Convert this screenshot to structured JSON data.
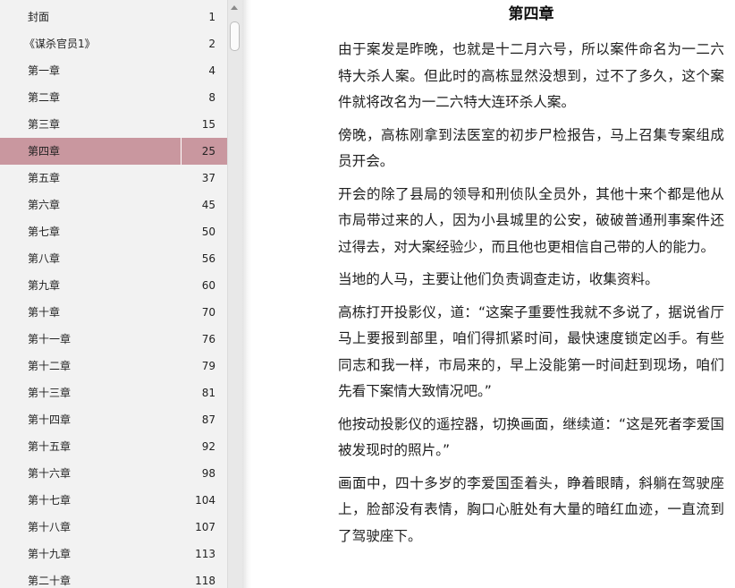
{
  "toc": {
    "items": [
      {
        "title": "封面",
        "page": "1"
      },
      {
        "title": "《谋杀官员1》",
        "page": "2"
      },
      {
        "title": "第一章",
        "page": "4"
      },
      {
        "title": "第二章",
        "page": "8"
      },
      {
        "title": "第三章",
        "page": "15"
      },
      {
        "title": "第四章",
        "page": "25",
        "active": true
      },
      {
        "title": "第五章",
        "page": "37"
      },
      {
        "title": "第六章",
        "page": "45"
      },
      {
        "title": "第七章",
        "page": "50"
      },
      {
        "title": "第八章",
        "page": "56"
      },
      {
        "title": "第九章",
        "page": "60"
      },
      {
        "title": "第十章",
        "page": "70"
      },
      {
        "title": "第十一章",
        "page": "76"
      },
      {
        "title": "第十二章",
        "page": "79"
      },
      {
        "title": "第十三章",
        "page": "81"
      },
      {
        "title": "第十四章",
        "page": "87"
      },
      {
        "title": "第十五章",
        "page": "92"
      },
      {
        "title": "第十六章",
        "page": "98"
      },
      {
        "title": "第十七章",
        "page": "104"
      },
      {
        "title": "第十八章",
        "page": "107"
      },
      {
        "title": "第十九章",
        "page": "113"
      },
      {
        "title": "第二十章",
        "page": "118"
      }
    ],
    "active_color": "#c9979f"
  },
  "chapter": {
    "title": "第四章",
    "paragraphs": [
      "由于案发是昨晚，也就是十二月六号，所以案件命名为一二六特大杀人案。但此时的高栋显然没想到，过不了多久，这个案件就将改名为一二六特大连环杀人案。",
      "傍晚，高栋刚拿到法医室的初步尸检报告，马上召集专案组成员开会。",
      "开会的除了县局的领导和刑侦队全员外，其他十来个都是他从市局带过来的人，因为小县城里的公安，破破普通刑事案件还过得去，对大案经验少，而且他也更相信自己带的人的能力。",
      "当地的人马，主要让他们负责调查走访，收集资料。",
      "高栋打开投影仪，道：“这案子重要性我就不多说了，据说省厅马上要报到部里，咱们得抓紧时间，最快速度锁定凶手。有些同志和我一样，市局来的，早上没能第一时间赶到现场，咱们先看下案情大致情况吧。”",
      "他按动投影仪的遥控器，切换画面，继续道：“这是死者李爱国被发现时的照片。”",
      "画面中，四十多岁的李爱国歪着头，睁着眼睛，斜躺在驾驶座上，脸部没有表情，胸口心脏处有大量的暗红血迹，一直流到了驾驶座下。"
    ]
  }
}
